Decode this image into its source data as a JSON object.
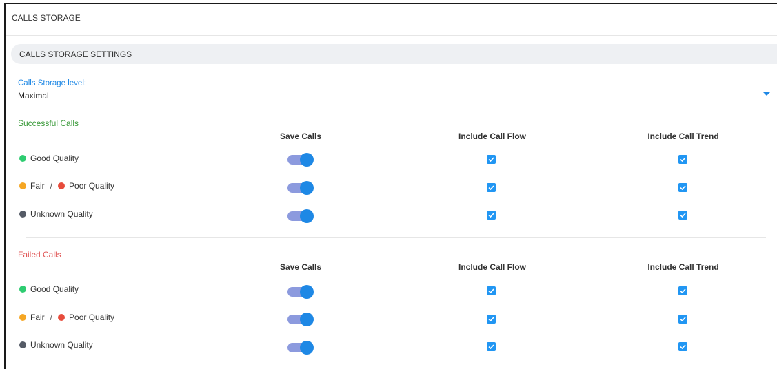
{
  "page": {
    "title": "CALLS STORAGE",
    "section_title": "CALLS STORAGE SETTINGS"
  },
  "storage_level": {
    "label": "Calls Storage level:",
    "value": "Maximal"
  },
  "columns": {
    "save": "Save Calls",
    "flow": "Include Call Flow",
    "trend": "Include Call Trend"
  },
  "labels": {
    "good": "Good Quality",
    "fair": "Fair",
    "separator": "/",
    "poor": "Poor Quality",
    "unknown": "Unknown Quality"
  },
  "groups": [
    {
      "title": "Successful Calls",
      "rows": [
        {
          "quality": "good",
          "save_calls": true,
          "include_call_flow": true,
          "include_call_trend": true
        },
        {
          "quality": "fair_poor",
          "save_calls": true,
          "include_call_flow": true,
          "include_call_trend": true
        },
        {
          "quality": "unknown",
          "save_calls": true,
          "include_call_flow": true,
          "include_call_trend": true
        }
      ]
    },
    {
      "title": "Failed Calls",
      "rows": [
        {
          "quality": "good",
          "save_calls": true,
          "include_call_flow": true,
          "include_call_trend": true
        },
        {
          "quality": "fair_poor",
          "save_calls": true,
          "include_call_flow": true,
          "include_call_trend": true
        },
        {
          "quality": "unknown",
          "save_calls": true,
          "include_call_flow": true,
          "include_call_trend": true
        }
      ]
    }
  ],
  "colors": {
    "accent": "#1e88e5",
    "good": "#2ecc71",
    "fair": "#f5a623",
    "poor": "#e74c3c",
    "unknown": "#555b66",
    "success_title": "#3a9a3a",
    "failed_title": "#e05555"
  },
  "icons": {
    "caret": "caret-down-icon",
    "check": "check-icon"
  }
}
